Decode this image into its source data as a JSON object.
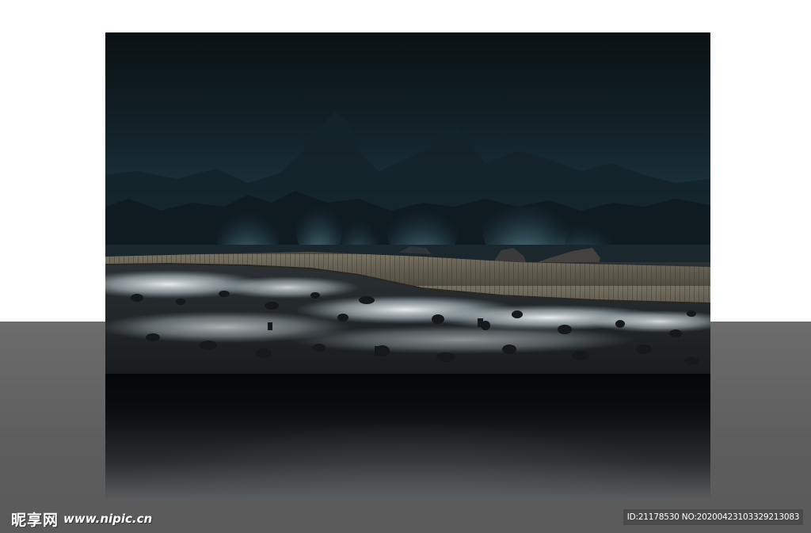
{
  "watermark": {
    "logo_text": "昵享网",
    "url_text": "www.nipic.cn",
    "id_text": "ID:21178530 NO:20200423103329213083"
  },
  "colors": {
    "sky_top": "#0b1216",
    "sky_mid": "#1c3038",
    "mist": "#e6eef2",
    "boardwalk": "#6f6a5e",
    "floor_gray": "#5d5d5d"
  }
}
